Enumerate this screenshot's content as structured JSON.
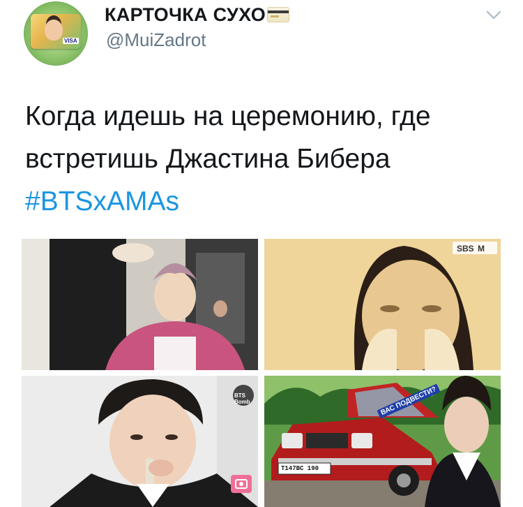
{
  "author": {
    "display_name": "КАРТОЧКА СУХО",
    "handle": "@MuiZadrot",
    "name_emoji_icon": "credit-card-icon",
    "avatar_badge": "VISA"
  },
  "tweet": {
    "text_lines": [
      "Когда идешь на церемонию, где",
      "встретишь Джастина Бибера"
    ],
    "hashtag": "#BTSxAMAs"
  },
  "menu_icon": "chevron-down-icon",
  "media": {
    "photo_3_watermark": "BTS Bomb",
    "photo_4_caption": "ВАС ПОДВЕСТИ?",
    "photo_4_plate": "Т147ВС 190"
  },
  "colors": {
    "text": "#14171a",
    "secondary": "#657786",
    "link": "#1b95e0"
  }
}
